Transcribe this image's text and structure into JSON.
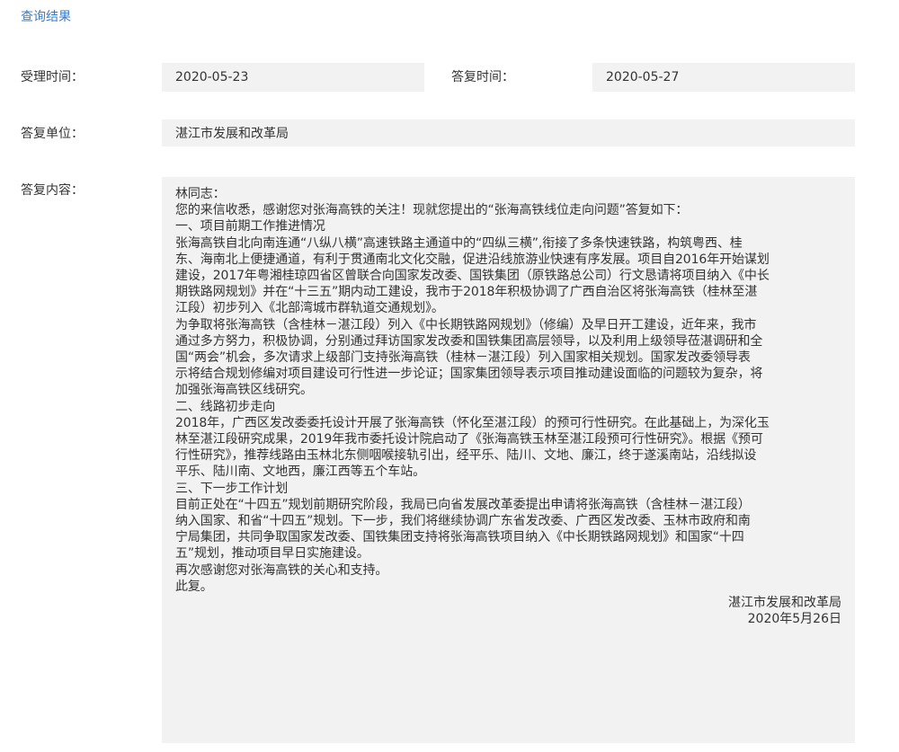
{
  "header": {
    "title": "查询结果"
  },
  "fields": {
    "accept_time": {
      "label": "受理时间：",
      "value": "2020-05-23"
    },
    "reply_time": {
      "label": "答复时间：",
      "value": "2020-05-27"
    },
    "reply_unit": {
      "label": "答复单位：",
      "value": "湛江市发展和改革局"
    },
    "reply_content": {
      "label": "答复内容："
    }
  },
  "content": {
    "lines": [
      "林同志：",
      "您的来信收悉，感谢您对张海高铁的关注！现就您提出的“张海高铁线位走向问题”答复如下：",
      "一、项目前期工作推进情况",
      "张海高铁自北向南连通“八纵八横”高速铁路主通道中的“四纵三横”,衔接了多条快速铁路，构筑粤西、桂",
      "东、海南北上便捷通道，有利于贯通南北文化交融，促进沿线旅游业快速有序发展。项目自2016年开始谋划",
      "建设，2017年粤湘桂琼四省区曾联合向国家发改委、国铁集团（原铁路总公司）行文恳请将项目纳入《中长",
      "期铁路网规划》并在“十三五”期内动工建设，我市于2018年积极协调了广西自治区将张海高铁（桂林至湛",
      "江段）初步列入《北部湾城市群轨道交通规划》。",
      "为争取将张海高铁（含桂林－湛江段）列入《中长期铁路网规划》（修编）及早日开工建设，近年来，我市",
      "通过多方努力，积极协调，分别通过拜访国家发改委和国铁集团高层领导，以及利用上级领导莅湛调研和全",
      "国“两会”机会，多次请求上级部门支持张海高铁（桂林－湛江段）列入国家相关规划。国家发改委领导表",
      "示将结合规划修编对项目建设可行性进一步论证；国家集团领导表示项目推动建设面临的问题较为复杂，将",
      "加强张海高铁区线研究。",
      "二、线路初步走向",
      "2018年，广西区发改委委托设计开展了张海高铁（怀化至湛江段）的预可行性研究。在此基础上，为深化玉",
      "林至湛江段研究成果，2019年我市委托设计院启动了《张海高铁玉林至湛江段预可行性研究》。根据《预可",
      "行性研究》，推荐线路由玉林北东侧咽喉接轨引出，经平乐、陆川、文地、廉江，终于遂溪南站，沿线拟设",
      "平乐、陆川南、文地西，廉江西等五个车站。",
      "三、下一步工作计划",
      "目前正处在“十四五”规划前期研究阶段，我局已向省发展改革委提出申请将张海高铁（含桂林－湛江段）",
      "纳入国家、和省“十四五”规划。下一步，我们将继续协调广东省发改委、广西区发改委、玉林市政府和南",
      "宁局集团，共同争取国家发改委、国铁集团支持将张海高铁项目纳入《中长期铁路网规划》和国家“十四",
      "五”规划，推动项目早日实施建设。",
      "再次感谢您对张海高铁的关心和支持。",
      "此复。"
    ],
    "signature": "湛江市发展和改革局",
    "date": "2020年5月26日"
  }
}
